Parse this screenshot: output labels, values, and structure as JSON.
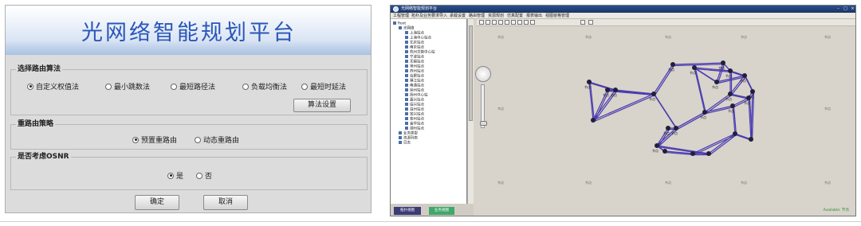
{
  "left_panel": {
    "title": "光网络智能规划平台",
    "algo_group": {
      "label": "选择路由算法",
      "options": [
        "自定义权值法",
        "最小跳数法",
        "最短路径法",
        "负载均衡法",
        "最短时延法"
      ],
      "selected_index": 0,
      "settings_button": "算法设置"
    },
    "reroute_group": {
      "label": "重路由策略",
      "options": [
        "预置重路由",
        "动态重路由"
      ],
      "selected_index": 0
    },
    "osnr_group": {
      "label": "是否考虑OSNR",
      "options": [
        "是",
        "否"
      ],
      "selected_index": 0
    },
    "confirm_button": "确定",
    "cancel_button": "取消"
  },
  "right_window": {
    "title": "光网络智能规划平台",
    "menu": [
      "工程管理",
      "拓扑及业务要求导入",
      "承载设置",
      "路由管理",
      "资源规划",
      "仿真配置",
      "报表输出",
      "视图窗格管理"
    ],
    "tree_root": "Root",
    "tree_level1": "光网络",
    "tree_nodes": [
      "上海站点",
      "上海中心站点",
      "北京站点",
      "南京站点",
      "杭州交换中心站",
      "宁波站点",
      "无锡站点",
      "常州站点",
      "苏州站点",
      "合肥站点",
      "镇江站点",
      "南通站点",
      "徐州站点",
      "扬州中心站",
      "嘉兴站点",
      "绍兴站点",
      "温州站点",
      "宜兴站点",
      "泰州站点",
      "金华站点",
      "湖州站点"
    ],
    "tree_other": [
      "业务类型",
      "资源列表",
      "日志"
    ],
    "tabs": [
      "拓扑视图",
      "业务视图"
    ],
    "map_labels": [
      "节点",
      "节点",
      "节点",
      "节点",
      "节点",
      "节点",
      "节点",
      "节点",
      "节点",
      "节点",
      "节点",
      "节点",
      "节点",
      "节点",
      "节点",
      "节点",
      "节点",
      "节点"
    ],
    "placeholder_node_label": "节点",
    "status_text": "Available: 节点",
    "link_color": "#4a3bb0",
    "node_color": "#20203a"
  }
}
